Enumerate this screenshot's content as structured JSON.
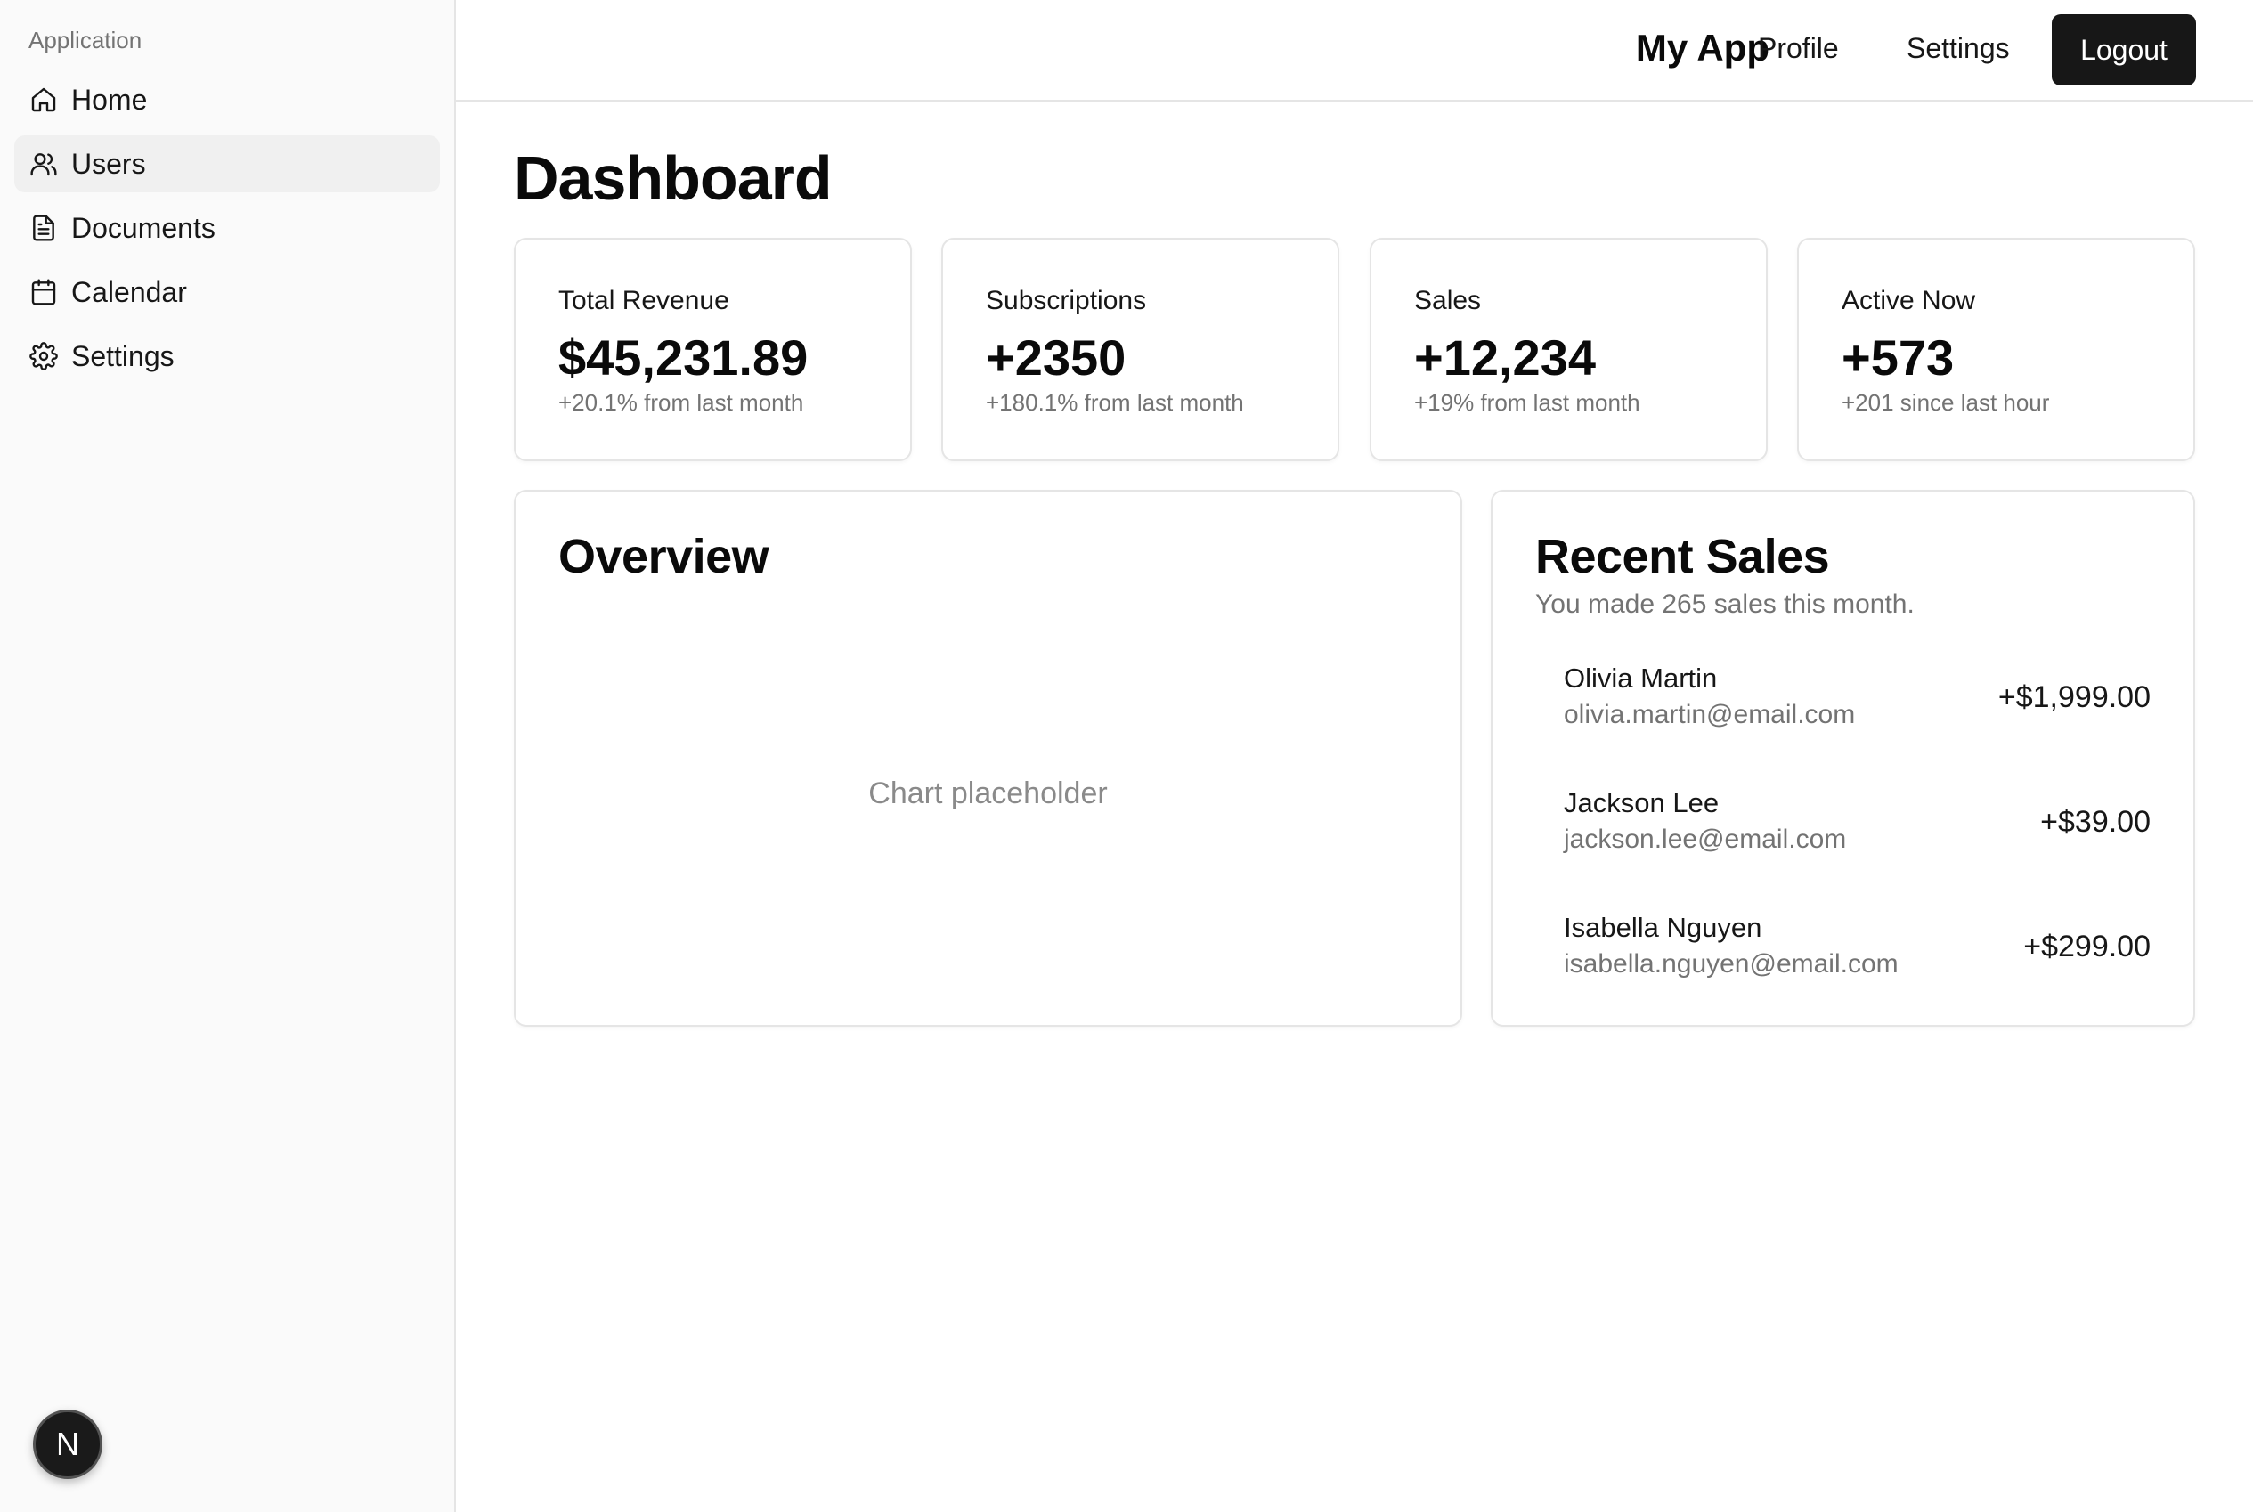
{
  "sidebar": {
    "group_label": "Application",
    "items": [
      {
        "label": "Home",
        "icon": "home-icon",
        "active": false
      },
      {
        "label": "Users",
        "icon": "users-icon",
        "active": true
      },
      {
        "label": "Documents",
        "icon": "document-icon",
        "active": false
      },
      {
        "label": "Calendar",
        "icon": "calendar-icon",
        "active": false
      },
      {
        "label": "Settings",
        "icon": "gear-icon",
        "active": false
      }
    ],
    "avatar_letter": "N"
  },
  "topnav": {
    "app_name": "My App",
    "profile_label": "Profile",
    "settings_label": "Settings",
    "logout_label": "Logout"
  },
  "main": {
    "title": "Dashboard",
    "stats": [
      {
        "title": "Total Revenue",
        "value": "$45,231.89",
        "delta": "+20.1% from last month"
      },
      {
        "title": "Subscriptions",
        "value": "+2350",
        "delta": "+180.1% from last month"
      },
      {
        "title": "Sales",
        "value": "+12,234",
        "delta": "+19% from last month"
      },
      {
        "title": "Active Now",
        "value": "+573",
        "delta": "+201 since last hour"
      }
    ],
    "overview": {
      "title": "Overview",
      "placeholder": "Chart placeholder"
    },
    "recent_sales": {
      "title": "Recent Sales",
      "subtitle": "You made 265 sales this month.",
      "rows": [
        {
          "name": "Olivia Martin",
          "email": "olivia.martin@email.com",
          "amount": "+$1,999.00"
        },
        {
          "name": "Jackson Lee",
          "email": "jackson.lee@email.com",
          "amount": "+$39.00"
        },
        {
          "name": "Isabella Nguyen",
          "email": "isabella.nguyen@email.com",
          "amount": "+$299.00"
        }
      ]
    }
  },
  "colors": {
    "sidebar_bg": "#fafafa",
    "active_item_bg": "#f0f0f0",
    "button_bg": "#171717",
    "muted_text": "#737373",
    "border": "#e5e5e5"
  }
}
